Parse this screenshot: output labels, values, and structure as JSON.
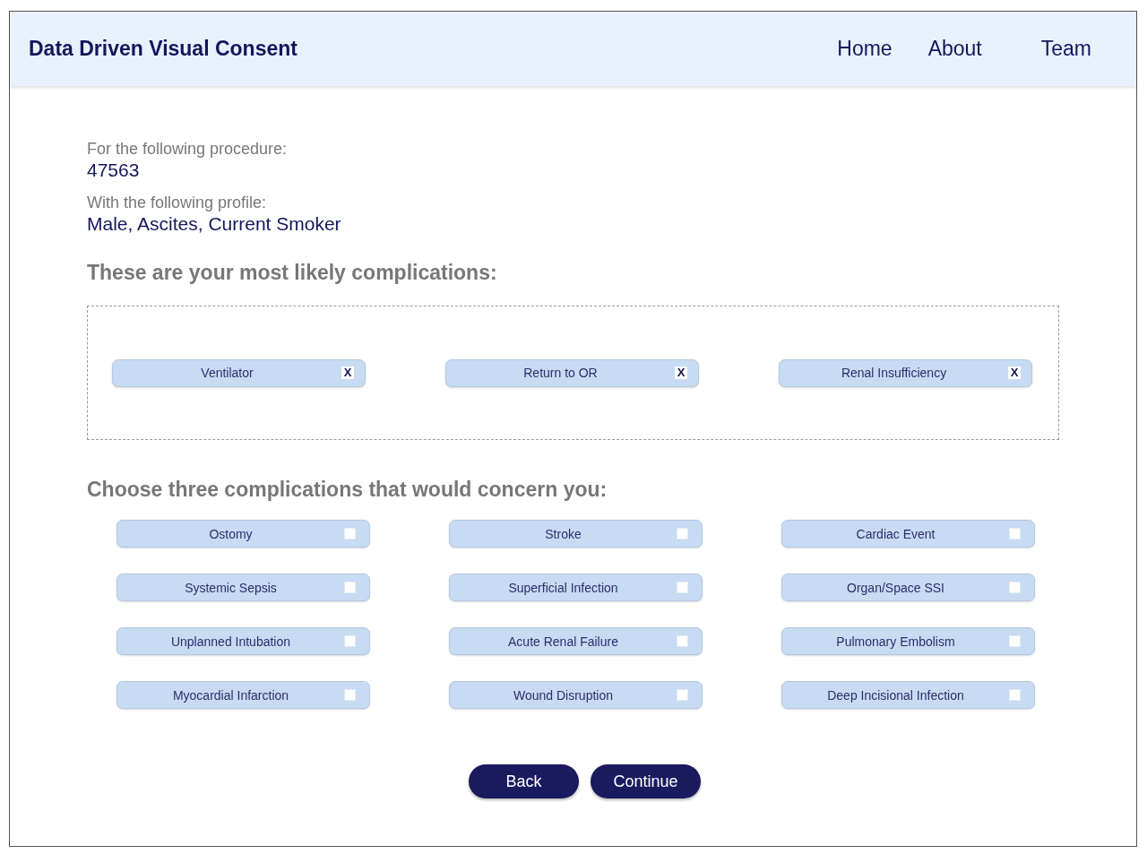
{
  "header": {
    "title": "Data Driven Visual Consent",
    "nav": [
      "Home",
      "About",
      "Team"
    ]
  },
  "procedure_label": "For the following procedure:",
  "procedure": "47563",
  "profile_label": "With the following profile:",
  "profile": "Male, Ascites, Current Smoker",
  "likely_heading": "These are your most likely complications:",
  "likely": [
    {
      "label": "Ventilator",
      "remove": "X"
    },
    {
      "label": "Return to OR",
      "remove": "X"
    },
    {
      "label": "Renal Insufficiency",
      "remove": "X"
    }
  ],
  "choose_heading": "Choose three complications that would concern you:",
  "choices": [
    {
      "label": "Ostomy",
      "checked": false
    },
    {
      "label": "Stroke",
      "checked": false
    },
    {
      "label": "Cardiac Event",
      "checked": false
    },
    {
      "label": "Systemic Sepsis",
      "checked": false
    },
    {
      "label": "Superficial Infection",
      "checked": false
    },
    {
      "label": "Organ/Space SSI",
      "checked": false
    },
    {
      "label": "Unplanned Intubation",
      "checked": false
    },
    {
      "label": "Acute Renal Failure",
      "checked": false
    },
    {
      "label": "Pulmonary Embolism",
      "checked": false
    },
    {
      "label": "Myocardial Infarction",
      "checked": false
    },
    {
      "label": "Wound Disruption",
      "checked": false
    },
    {
      "label": "Deep Incisional Infection",
      "checked": false
    }
  ],
  "buttons": [
    "Back",
    "Continue"
  ]
}
